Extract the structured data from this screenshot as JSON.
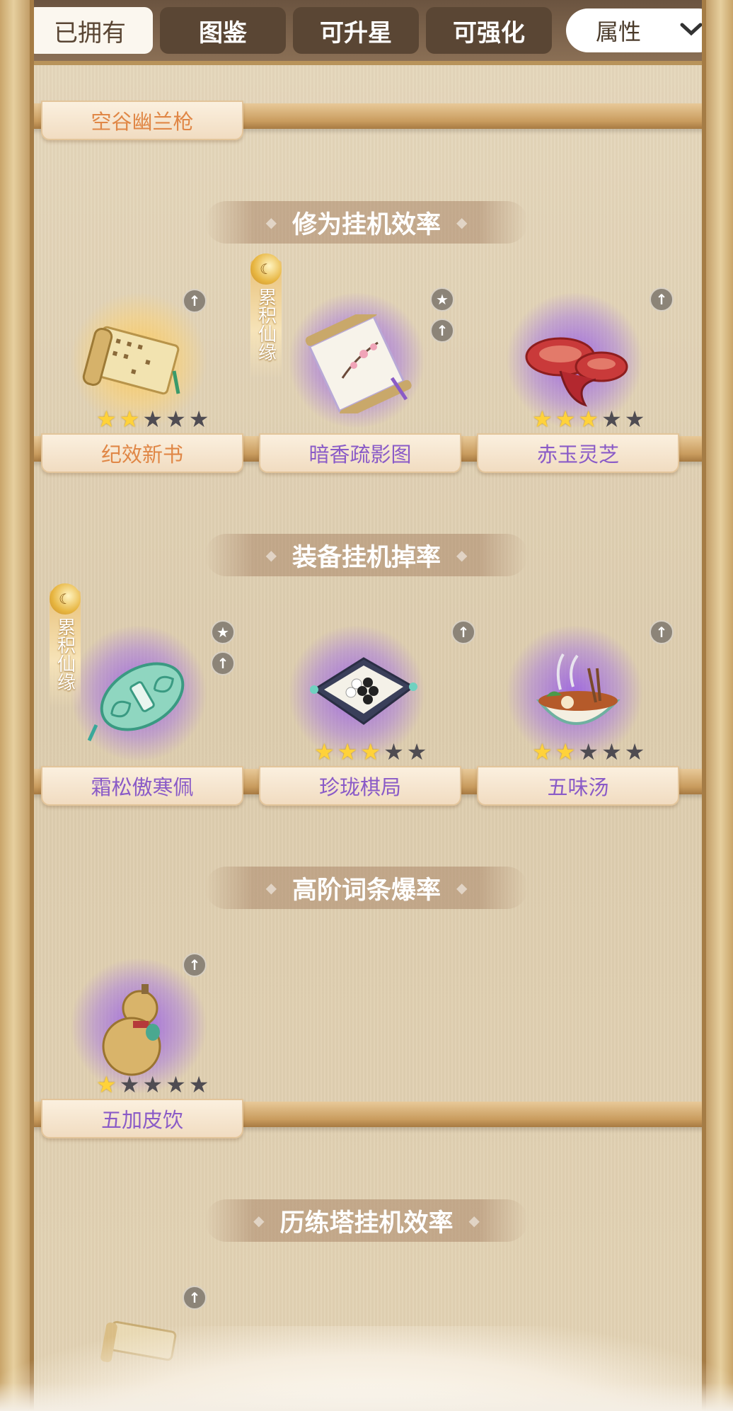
{
  "tabs": [
    {
      "label": "已拥有",
      "active": true
    },
    {
      "label": "图鉴",
      "active": false
    },
    {
      "label": "可升星",
      "active": false
    },
    {
      "label": "可强化",
      "active": false
    }
  ],
  "filter": {
    "label": "属性",
    "icon": "chevron-down-icon"
  },
  "top_item": {
    "name": "空谷幽兰枪"
  },
  "sections": [
    {
      "title": "修为挂机效率",
      "items": [
        {
          "name": "纪效新书",
          "rarity": "gold",
          "stars": 2,
          "max_stars": 5,
          "badges": [
            "upgrade"
          ],
          "fate_ribbon": false
        },
        {
          "name": "暗香疏影图",
          "rarity": "purple",
          "stars": 0,
          "max_stars": 5,
          "badges": [
            "star",
            "upgrade"
          ],
          "fate_ribbon": true
        },
        {
          "name": "赤玉灵芝",
          "rarity": "purple",
          "stars": 3,
          "max_stars": 5,
          "badges": [
            "upgrade"
          ],
          "fate_ribbon": false
        }
      ]
    },
    {
      "title": "装备挂机掉率",
      "items": [
        {
          "name": "霜松傲寒佩",
          "rarity": "purple",
          "stars": 0,
          "max_stars": 5,
          "badges": [
            "star",
            "upgrade"
          ],
          "fate_ribbon": true
        },
        {
          "name": "珍珑棋局",
          "rarity": "purple",
          "stars": 3,
          "max_stars": 5,
          "badges": [
            "upgrade"
          ],
          "fate_ribbon": false
        },
        {
          "name": "五味汤",
          "rarity": "purple",
          "stars": 2,
          "max_stars": 5,
          "badges": [
            "upgrade"
          ],
          "fate_ribbon": false
        }
      ]
    },
    {
      "title": "高阶词条爆率",
      "items": [
        {
          "name": "五加皮饮",
          "rarity": "purple",
          "stars": 1,
          "max_stars": 5,
          "badges": [
            "upgrade"
          ],
          "fate_ribbon": false
        }
      ]
    },
    {
      "title": "历练塔挂机效率",
      "items": []
    }
  ],
  "fate_ribbon_text": "累积仙缘",
  "colors": {
    "tab_bar": "#6b5440",
    "tab_active_bg": "#fbf7ef",
    "purple_name": "#8a5bc7",
    "orange_name": "#e08746",
    "star_on": "#ffd23a",
    "star_off": "#4f4c52"
  }
}
